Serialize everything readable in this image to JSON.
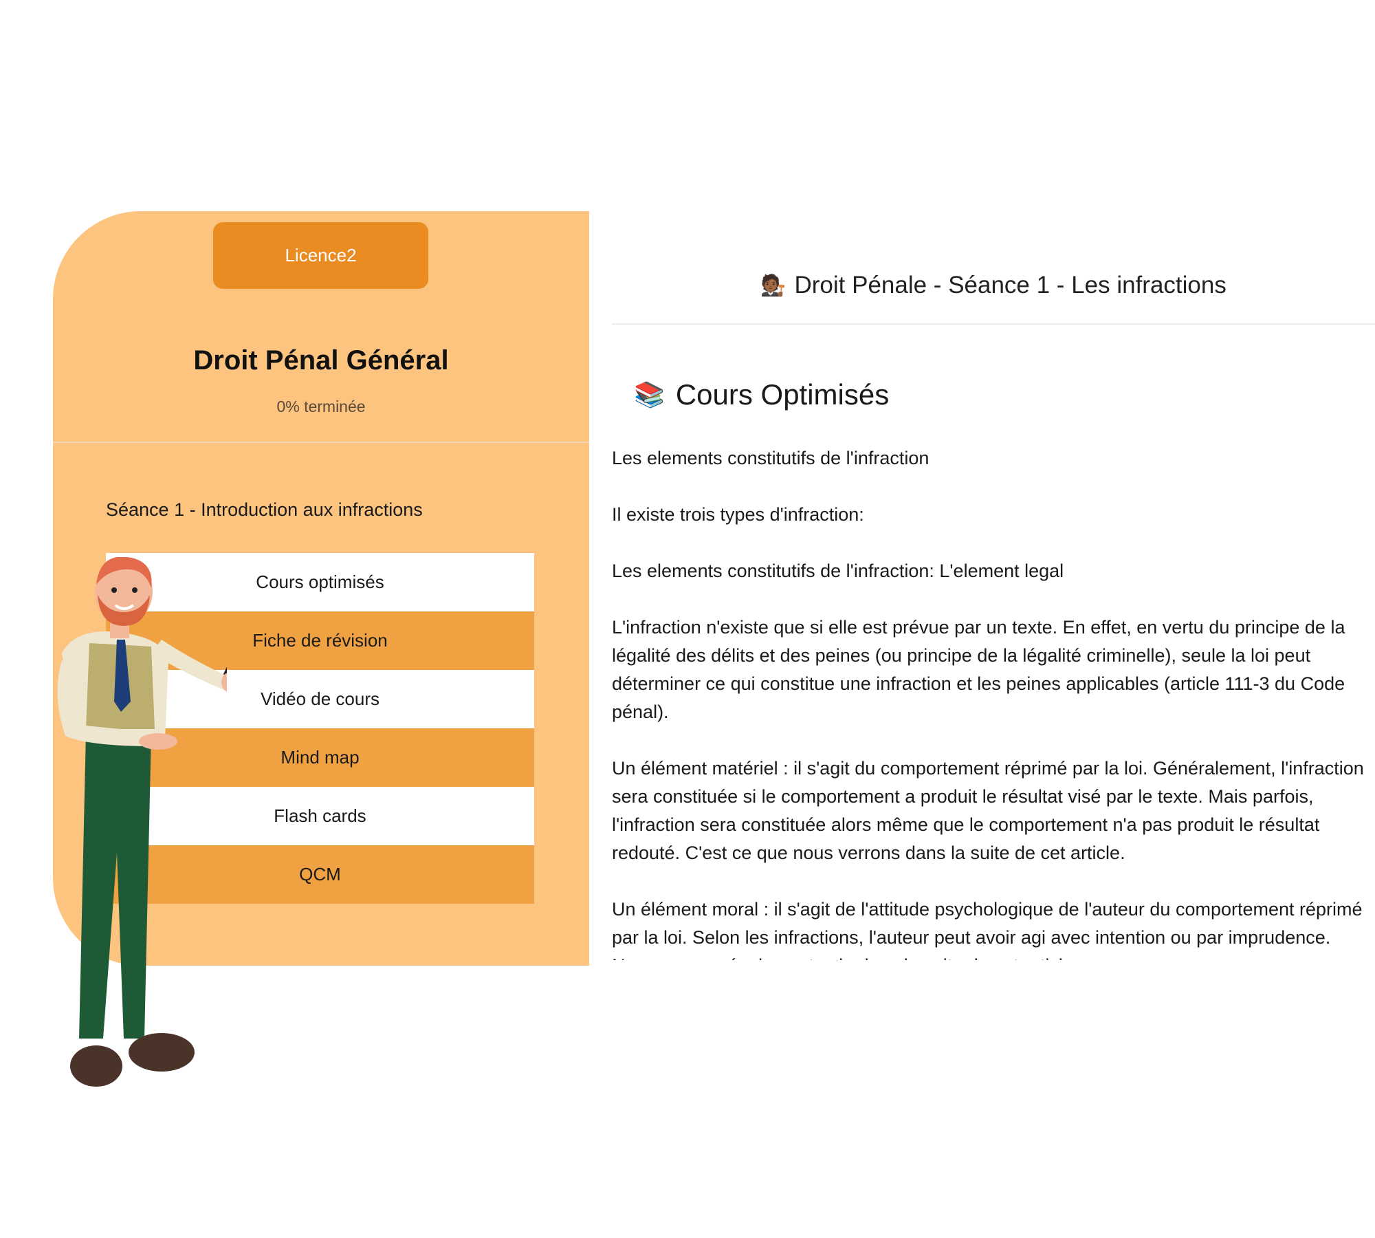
{
  "sidebar": {
    "level_badge": "Licence2",
    "course_title": "Droit Pénal Général",
    "progress_text": "0% terminée",
    "session_title": "Séance 1 - Introduction aux infractions",
    "menu": [
      {
        "label": "Cours optimisés",
        "style": "white"
      },
      {
        "label": "Fiche de révision",
        "style": "orange"
      },
      {
        "label": "Vidéo de cours",
        "style": "white"
      },
      {
        "label": "Mind map",
        "style": "orange"
      },
      {
        "label": "Flash cards",
        "style": "white"
      },
      {
        "label": "QCM",
        "style": "orange"
      }
    ]
  },
  "content": {
    "header_emoji": "🧑🏾‍⚖️",
    "header_title": "Droit Pénale - Séance 1 - Les infractions",
    "section_emoji": "📚",
    "section_title": "Cours Optimisés",
    "paragraphs": [
      "Les elements constitutifs de l'infraction",
      "Il existe trois types d'infraction:",
      "Les elements constitutifs de l'infraction: L'element legal",
      "L'infraction n'existe que si elle est prévue par un texte. En effet, en vertu du principe de la légalité des délits et des peines (ou principe de la légalité criminelle), seule la loi peut déterminer ce qui constitue une infraction et les peines applicables (article 111-3 du Code pénal).",
      "Un élément matériel : il s'agit du comportement réprimé par la loi. Généralement, l'infraction sera constituée si le comportement a produit le résultat visé par le texte. Mais parfois, l'infraction sera constituée alors même que le comportement n'a pas produit le résultat redouté. C'est ce que nous verrons dans la suite de cet article.",
      "Un élément moral : il s'agit de l'attitude psychologique de l'auteur du comportement réprimé par la loi. Selon les infractions, l'auteur peut avoir agi avec intention ou par imprudence. Nous verrons également cela dans la suite de cet article."
    ]
  },
  "colors": {
    "panel_bg": "#fdc47f",
    "badge_bg": "#ea8c22",
    "menu_orange": "#f0a243"
  },
  "illustration": "teacher-character-with-pointer"
}
